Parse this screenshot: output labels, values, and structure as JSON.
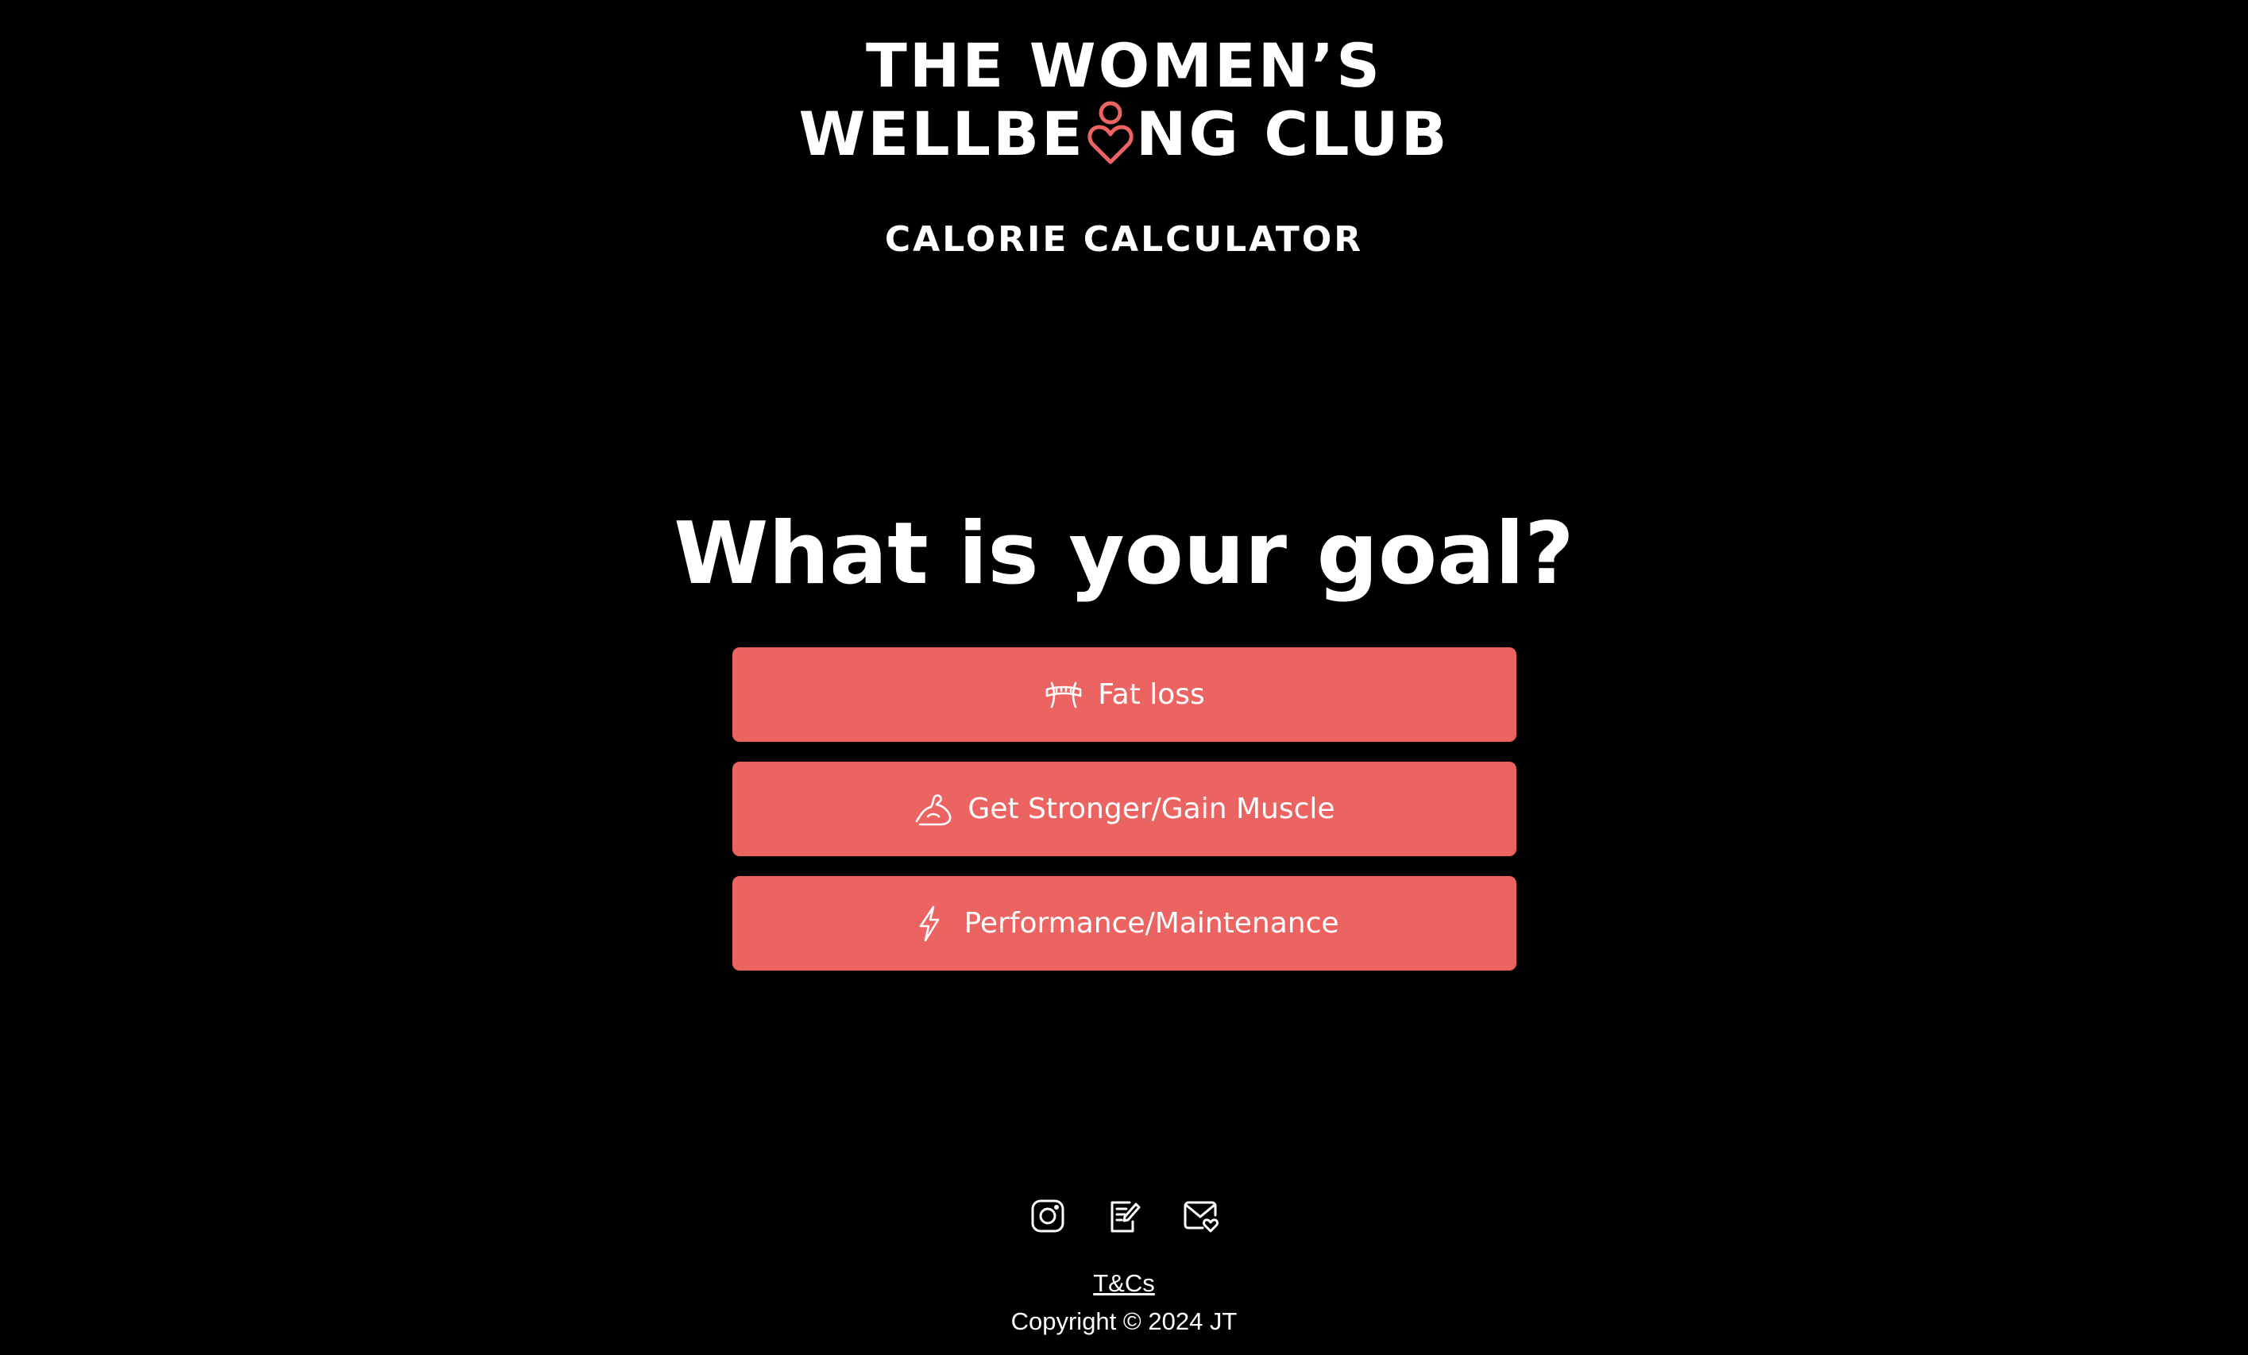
{
  "brand": {
    "line1": "THE WOMEN’S",
    "line2_before": "WELLBE",
    "line2_after": "NG CLUB",
    "logo_mark_icon": "person-heart-icon",
    "accent_color": "#ec6461"
  },
  "page": {
    "subtitle": "CALORIE CALCULATOR",
    "question": "What is your goal?"
  },
  "goals": [
    {
      "label": "Fat loss",
      "icon": "waist-measure-icon"
    },
    {
      "label": "Get Stronger/Gain Muscle",
      "icon": "flexed-arm-icon"
    },
    {
      "label": "Performance/Maintenance",
      "icon": "lightning-bolt-icon"
    }
  ],
  "footer": {
    "icons": [
      "instagram-icon",
      "blog-edit-icon",
      "mail-heart-icon"
    ],
    "tcs_label": "T&Cs",
    "copyright": "Copyright © 2024 JT"
  },
  "colors": {
    "background": "#000000",
    "button": "#ec6461",
    "text": "#ffffff"
  }
}
